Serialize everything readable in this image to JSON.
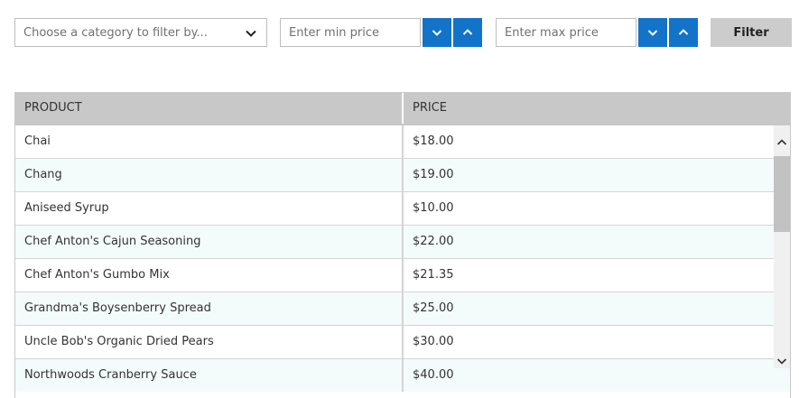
{
  "filters": {
    "category_placeholder": "Choose a category to filter by...",
    "min_price_placeholder": "Enter min price",
    "max_price_placeholder": "Enter max price",
    "filter_button_label": "Filter",
    "spin_button_color": "#1273c9"
  },
  "grid": {
    "columns": [
      "PRODUCT",
      "PRICE"
    ],
    "rows": [
      {
        "product": "Chai",
        "price": "$18.00"
      },
      {
        "product": "Chang",
        "price": "$19.00"
      },
      {
        "product": "Aniseed Syrup",
        "price": "$10.00"
      },
      {
        "product": "Chef Anton's Cajun Seasoning",
        "price": "$22.00"
      },
      {
        "product": "Chef Anton's Gumbo Mix",
        "price": "$21.35"
      },
      {
        "product": "Grandma's Boysenberry Spread",
        "price": "$25.00"
      },
      {
        "product": "Uncle Bob's Organic Dried Pears",
        "price": "$30.00"
      },
      {
        "product": "Northwoods Cranberry Sauce",
        "price": "$40.00"
      }
    ]
  },
  "icons": {
    "dropdown": "chevron-down-icon",
    "decrement": "chevron-down-icon",
    "increment": "chevron-up-icon",
    "scroll_up": "chevron-up-icon",
    "scroll_down": "chevron-down-icon"
  }
}
